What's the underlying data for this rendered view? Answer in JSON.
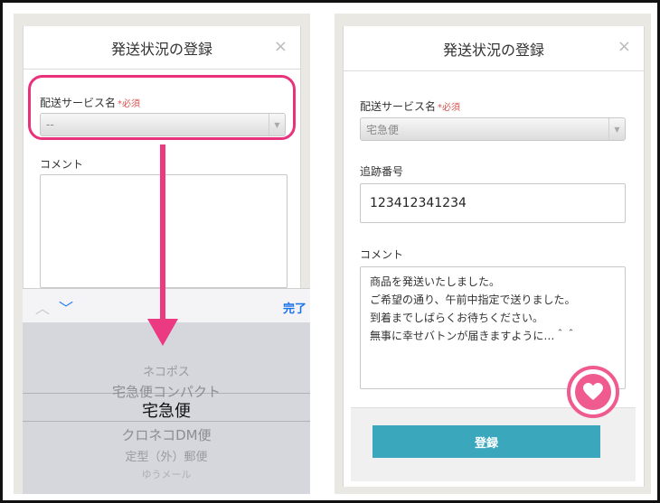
{
  "left": {
    "modal_title": "発送状況の登録",
    "close_glyph": "×",
    "service_label": "配送サービス名",
    "required_mark": "*必須",
    "service_select_value": "--",
    "comment_label": "コメント",
    "toolbar": {
      "prev_glyph": "︿",
      "next_glyph": "﹀",
      "done_label": "完了"
    },
    "picker_items": [
      "ネコポス",
      "宅急便コンパクト",
      "宅急便",
      "クロネコDM便",
      "定型（外）郵便",
      "ゆうメール"
    ],
    "picker_selected": "宅急便"
  },
  "right": {
    "modal_title": "発送状況の登録",
    "close_glyph": "×",
    "service_label": "配送サービス名",
    "required_mark": "*必須",
    "service_select_value": "宅急便",
    "tracking_label": "追跡番号",
    "tracking_value": "123412341234",
    "comment_label": "コメント",
    "comment_lines": [
      "商品を発送いたしました。",
      "ご希望の通り、午前中指定で送りました。",
      "到着までしばらくお待ちください。",
      "無事に幸せバトンが届きますように…＾＾"
    ],
    "submit_label": "登録"
  },
  "colors": {
    "highlight": "#e8327c",
    "button": "#3aa7bd",
    "heart": "#ef5a8f"
  }
}
